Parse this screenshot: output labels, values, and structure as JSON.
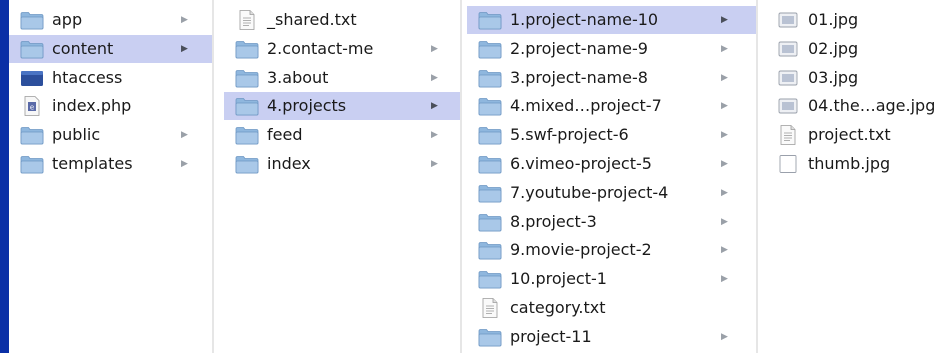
{
  "columns": [
    {
      "items": [
        {
          "label": "app",
          "icon": "folder-icon",
          "arrow": true,
          "selected": false
        },
        {
          "label": "content",
          "icon": "folder-icon",
          "arrow": true,
          "selected": true
        },
        {
          "label": "htaccess",
          "icon": "dark-file-icon",
          "arrow": false,
          "selected": false
        },
        {
          "label": "index.php",
          "icon": "php-file-icon",
          "arrow": false,
          "selected": false
        },
        {
          "label": "public",
          "icon": "folder-icon",
          "arrow": true,
          "selected": false
        },
        {
          "label": "templates",
          "icon": "folder-icon",
          "arrow": true,
          "selected": false
        }
      ]
    },
    {
      "items": [
        {
          "label": "_shared.txt",
          "icon": "text-file-icon",
          "arrow": false,
          "selected": false
        },
        {
          "label": "2.contact-me",
          "icon": "folder-icon",
          "arrow": true,
          "selected": false
        },
        {
          "label": "3.about",
          "icon": "folder-icon",
          "arrow": true,
          "selected": false
        },
        {
          "label": "4.projects",
          "icon": "folder-icon",
          "arrow": true,
          "selected": true
        },
        {
          "label": "feed",
          "icon": "folder-icon",
          "arrow": true,
          "selected": false
        },
        {
          "label": "index",
          "icon": "folder-icon",
          "arrow": true,
          "selected": false
        }
      ]
    },
    {
      "items": [
        {
          "label": "1.project-name-10",
          "icon": "folder-icon",
          "arrow": true,
          "selected": true
        },
        {
          "label": "2.project-name-9",
          "icon": "folder-icon",
          "arrow": true,
          "selected": false
        },
        {
          "label": "3.project-name-8",
          "icon": "folder-icon",
          "arrow": true,
          "selected": false
        },
        {
          "label": "4.mixed…project-7",
          "icon": "folder-icon",
          "arrow": true,
          "selected": false
        },
        {
          "label": "5.swf-project-6",
          "icon": "folder-icon",
          "arrow": true,
          "selected": false
        },
        {
          "label": "6.vimeo-project-5",
          "icon": "folder-icon",
          "arrow": true,
          "selected": false
        },
        {
          "label": "7.youtube-project-4",
          "icon": "folder-icon",
          "arrow": true,
          "selected": false
        },
        {
          "label": "8.project-3",
          "icon": "folder-icon",
          "arrow": true,
          "selected": false
        },
        {
          "label": "9.movie-project-2",
          "icon": "folder-icon",
          "arrow": true,
          "selected": false
        },
        {
          "label": "10.project-1",
          "icon": "folder-icon",
          "arrow": true,
          "selected": false
        },
        {
          "label": "category.txt",
          "icon": "text-file-icon",
          "arrow": false,
          "selected": false
        },
        {
          "label": "project-11",
          "icon": "folder-icon",
          "arrow": true,
          "selected": false
        }
      ]
    },
    {
      "items": [
        {
          "label": "01.jpg",
          "icon": "image-file-icon",
          "arrow": false,
          "selected": false
        },
        {
          "label": "02.jpg",
          "icon": "image-file-icon",
          "arrow": false,
          "selected": false
        },
        {
          "label": "03.jpg",
          "icon": "image-file-icon",
          "arrow": false,
          "selected": false
        },
        {
          "label": "04.the…age.jpg",
          "icon": "image-file-icon",
          "arrow": false,
          "selected": false
        },
        {
          "label": "project.txt",
          "icon": "text-file-icon",
          "arrow": false,
          "selected": false
        },
        {
          "label": "thumb.jpg",
          "icon": "blank-file-icon",
          "arrow": false,
          "selected": false
        }
      ]
    }
  ],
  "colors": {
    "background": "#0a2fa6",
    "selection": "#c9cff2",
    "folder": "#8fb7de",
    "arrow": "#9aa0a8"
  }
}
